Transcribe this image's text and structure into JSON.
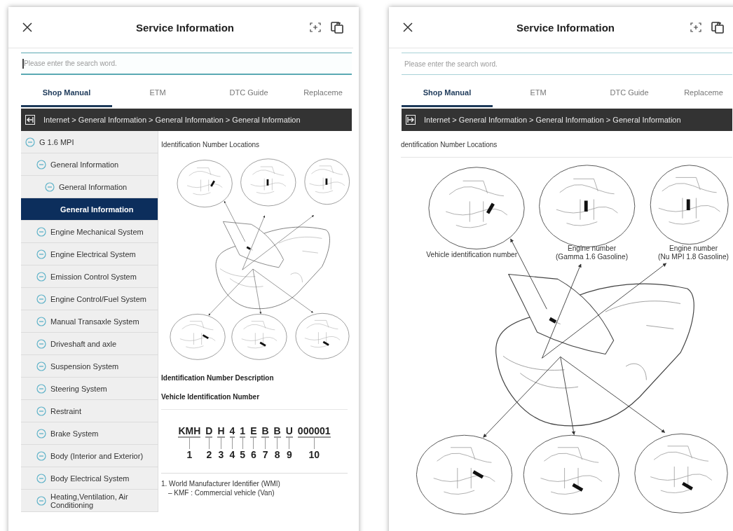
{
  "panels": [
    {
      "title": "Service Information",
      "search": {
        "placeholder": "Please enter the search word.",
        "focused": true
      },
      "tabs": [
        {
          "label": "Shop Manual",
          "selected": true
        },
        {
          "label": "ETM",
          "selected": false
        },
        {
          "label": "DTC Guide",
          "selected": false
        },
        {
          "label": "Replaceme",
          "selected": false
        }
      ],
      "breadcrumb": {
        "text": "Internet > General Information > General Information > General Information",
        "sidebar_open": true
      },
      "tree": [
        {
          "label": "G 1.6 MPI",
          "expanded": true,
          "selected": false,
          "children": [
            {
              "label": "General Information",
              "expanded": true,
              "selected": false,
              "children": [
                {
                  "label": "General Information",
                  "expanded": true,
                  "selected": false,
                  "children": [
                    {
                      "label": "General Information",
                      "selected": true
                    }
                  ]
                }
              ]
            },
            {
              "label": "Engine Mechanical System",
              "expanded": true,
              "selected": false
            },
            {
              "label": "Engine Electrical System",
              "expanded": true,
              "selected": false
            },
            {
              "label": "Emission Control System",
              "expanded": true,
              "selected": false
            },
            {
              "label": "Engine Control/Fuel System",
              "expanded": true,
              "selected": false
            },
            {
              "label": "Manual Transaxle System",
              "expanded": true,
              "selected": false
            },
            {
              "label": "Driveshaft and axle",
              "expanded": true,
              "selected": false
            },
            {
              "label": "Suspension System",
              "expanded": true,
              "selected": false
            },
            {
              "label": "Steering System",
              "expanded": true,
              "selected": false
            },
            {
              "label": "Restraint",
              "expanded": true,
              "selected": false
            },
            {
              "label": "Brake System",
              "expanded": true,
              "selected": false
            },
            {
              "label": "Body (Interior and Exterior)",
              "expanded": true,
              "selected": false
            },
            {
              "label": "Body Electrical System",
              "expanded": true,
              "selected": false
            },
            {
              "label": "Heating,Ventilation, Air Conditioning",
              "expanded": true,
              "selected": false
            }
          ]
        }
      ],
      "content": [
        {
          "kind": "heading",
          "text": "Identification Number Locations"
        },
        {
          "kind": "figure"
        },
        {
          "kind": "subheading",
          "text": "Identification Number Description"
        },
        {
          "kind": "subheading",
          "text": "Vehicle Identification Number"
        },
        {
          "kind": "vin",
          "segments": [
            {
              "code": "KMH",
              "index": "1"
            },
            {
              "code": "D",
              "index": "2"
            },
            {
              "code": "H",
              "index": "3"
            },
            {
              "code": "4",
              "index": "4"
            },
            {
              "code": "1",
              "index": "5"
            },
            {
              "code": "E",
              "index": "6"
            },
            {
              "code": "B",
              "index": "7"
            },
            {
              "code": "B",
              "index": "8"
            },
            {
              "code": "U",
              "index": "9"
            },
            {
              "code": "000001",
              "index": "10"
            }
          ]
        },
        {
          "kind": "list",
          "items": [
            {
              "text": "1. World Manufacturer Identifier (WMI)",
              "children": [
                {
                  "text": "– KMF : Commercial vehicle (Van)"
                }
              ]
            }
          ]
        }
      ]
    },
    {
      "title": "Service Information",
      "search": {
        "placeholder": "Please enter the search word.",
        "focused": false
      },
      "tabs": [
        {
          "label": "Shop Manual",
          "selected": true
        },
        {
          "label": "ETM",
          "selected": false
        },
        {
          "label": "DTC Guide",
          "selected": false
        },
        {
          "label": "Replaceme",
          "selected": false
        }
      ],
      "breadcrumb": {
        "text": "Internet > General Information > General Information > General Information",
        "sidebar_open": false
      },
      "content": [
        {
          "kind": "heading",
          "text": "dentification Number Locations"
        },
        {
          "kind": "figure",
          "labels": [
            {
              "lines": [
                "Vehicle identification number"
              ]
            },
            {
              "lines": [
                "Engine number",
                "(Gamma 1.6 Gasoline)"
              ]
            },
            {
              "lines": [
                "Engine number",
                "(Nu MPI 1.8 Gasoline)"
              ]
            }
          ]
        }
      ]
    }
  ]
}
